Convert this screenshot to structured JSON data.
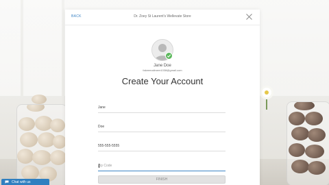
{
  "modal": {
    "back_label": "BACK",
    "title": "Dr. Zoey St Laurent's Wellevate Store",
    "close_icon": "close-icon"
  },
  "profile": {
    "avatar_icon": "user-avatar-icon",
    "badge_icon": "checkmark-icon",
    "name": "Jane Doe",
    "email": "fakeemailmem1038@gmail.com"
  },
  "form": {
    "heading": "Create Your Account",
    "first_name": {
      "value": "Jane",
      "placeholder": ""
    },
    "last_name": {
      "value": "Doe",
      "placeholder": ""
    },
    "phone": {
      "value": "555-555-5555",
      "placeholder": ""
    },
    "zip_code": {
      "value": "",
      "placeholder": "Zip Code"
    },
    "finish_label": "FINISH"
  },
  "chat": {
    "label": "Chat with us",
    "icon": "chat-bubble-icon"
  },
  "colors": {
    "accent": "#3b83c4",
    "chat_bg": "#2f7fc0",
    "badge_green": "#5cb85c",
    "button_disabled": "#e2e2e2"
  }
}
